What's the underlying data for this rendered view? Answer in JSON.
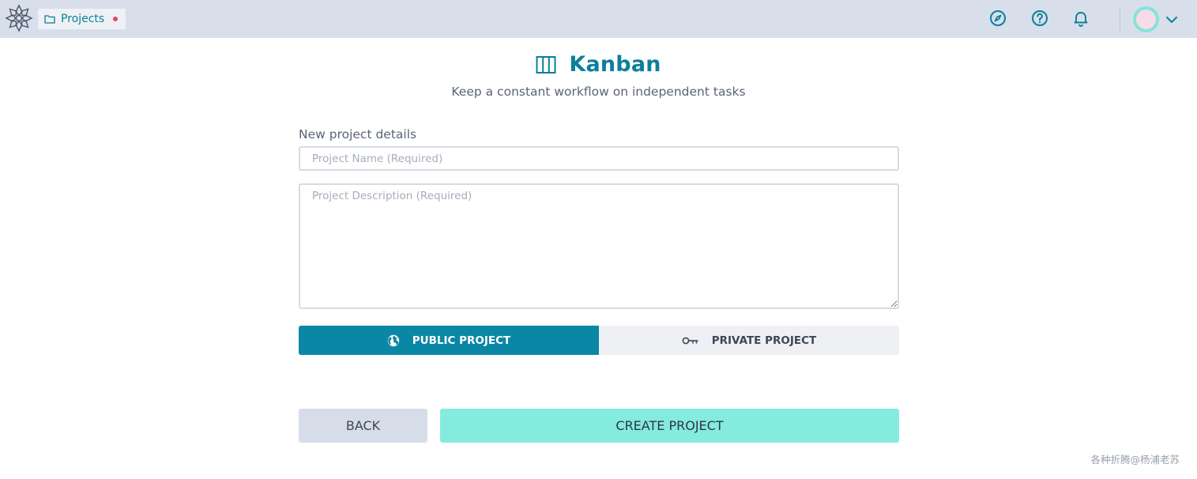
{
  "header": {
    "projects_tab_label": "Projects",
    "icons": [
      "compass-icon",
      "help-icon",
      "bell-icon"
    ],
    "notification_dot_color": "#e8475f"
  },
  "page": {
    "title": "Kanban",
    "subtitle": "Keep a constant workflow on independent tasks"
  },
  "form": {
    "section_label": "New project details",
    "name_placeholder": "Project Name (Required)",
    "name_value": "",
    "description_placeholder": "Project Description (Required)",
    "description_value": "",
    "visibility": {
      "selected": "public",
      "public_label": "PUBLIC PROJECT",
      "private_label": "PRIVATE PROJECT"
    },
    "back_label": "BACK",
    "create_label": "CREATE PROJECT"
  },
  "watermark": "各种折腾@杨浦老苏",
  "colors": {
    "brand": "#0a87a5",
    "topbar": "#d8dfea",
    "create_button": "#84ebde",
    "back_button": "#d7dde8"
  }
}
